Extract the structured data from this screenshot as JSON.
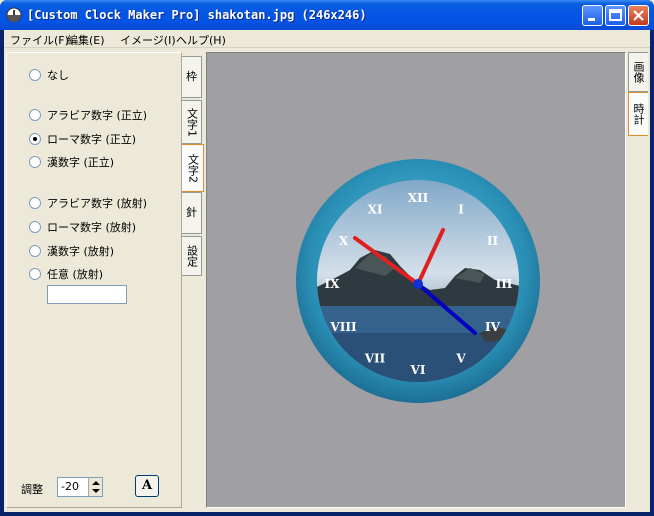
{
  "window": {
    "title": "[Custom Clock Maker Pro] shakotan.jpg (246x246)"
  },
  "menu": [
    "ファイル(F)",
    "編集(E)",
    "イメージ(I)",
    "ヘルプ(H)"
  ],
  "left_tabs": [
    {
      "label": "枠",
      "active": false
    },
    {
      "label": "文字1",
      "active": false
    },
    {
      "label": "文字2",
      "active": true
    },
    {
      "label": "針",
      "active": false
    },
    {
      "label": "設定",
      "active": false
    }
  ],
  "right_tabs": [
    {
      "label": "画像",
      "active": false
    },
    {
      "label": "時計",
      "active": true
    }
  ],
  "options": {
    "none": {
      "label": "なし",
      "checked": false
    },
    "arabic_upright": {
      "label": "アラビア数字 (正立)",
      "checked": false
    },
    "roman_upright": {
      "label": "ローマ数字 (正立)",
      "checked": true
    },
    "kanji_upright": {
      "label": "漢数字 (正立)",
      "checked": false
    },
    "arabic_radial": {
      "label": "アラビア数字 (放射)",
      "checked": false
    },
    "roman_radial": {
      "label": "ローマ数字 (放射)",
      "checked": false
    },
    "kanji_radial": {
      "label": "漢数字 (放射)",
      "checked": false
    },
    "custom_radial": {
      "label": "任意 (放射)",
      "checked": false
    }
  },
  "custom_text": "",
  "adjust": {
    "label": "調整",
    "value": "-20"
  },
  "font_button": "A",
  "clock": {
    "numerals": [
      "XII",
      "I",
      "II",
      "III",
      "IV",
      "V",
      "VI",
      "VII",
      "VIII",
      "IX",
      "X",
      "XI"
    ],
    "ring_color": "#2a8fb5",
    "hour_hand_color": "#e02020",
    "minute_hand_color": "#0000c0",
    "second_hand_color": "#e02020"
  },
  "colors": {
    "canvas_bg": "#a0a0a4",
    "face_bg": "#ece9d8"
  }
}
